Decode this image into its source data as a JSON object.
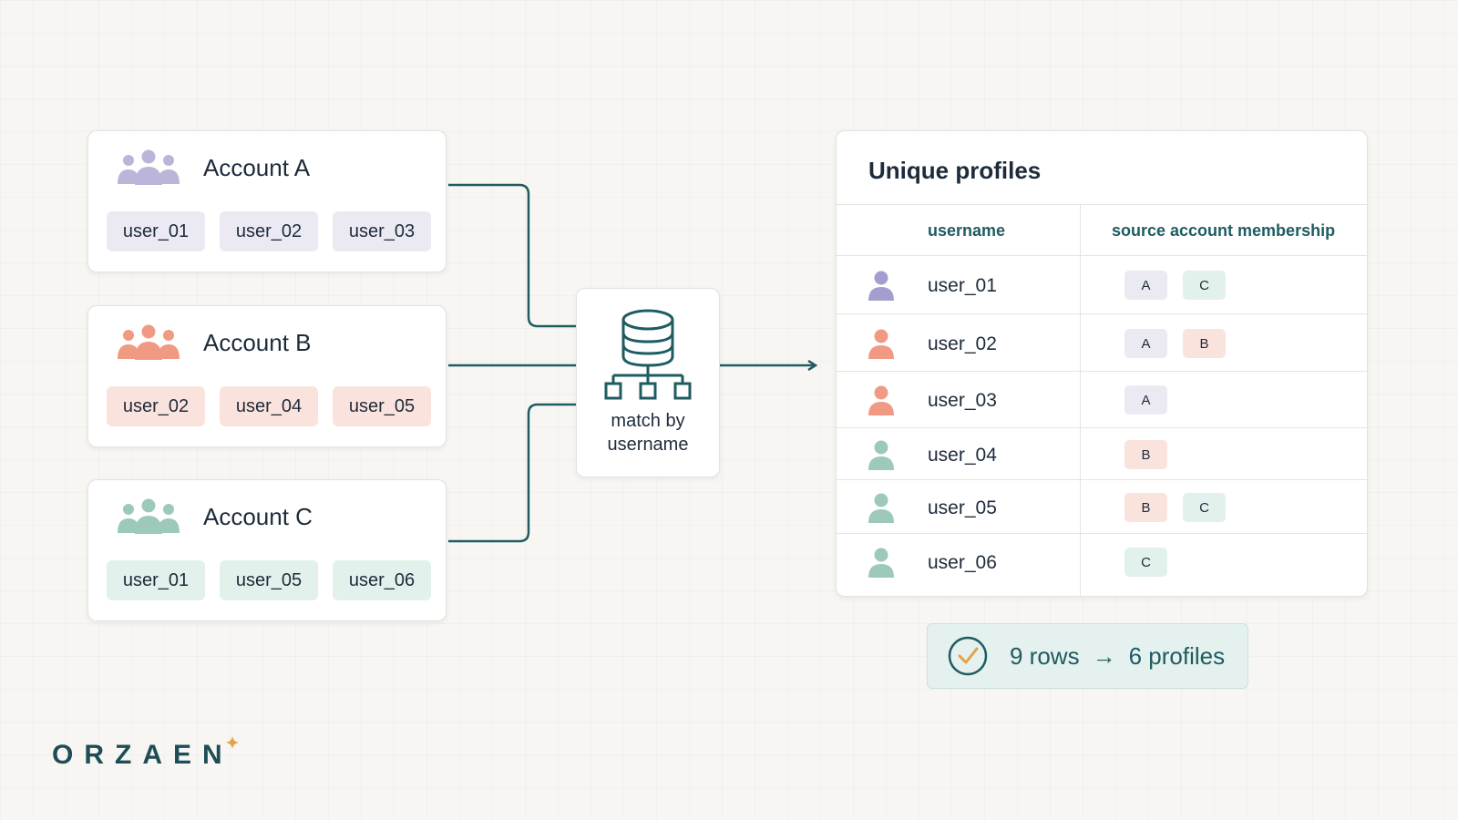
{
  "accounts": [
    {
      "title": "Account A",
      "users": [
        "user_01",
        "user_02",
        "user_03"
      ]
    },
    {
      "title": "Account B",
      "users": [
        "user_02",
        "user_04",
        "user_05"
      ]
    },
    {
      "title": "Account C",
      "users": [
        "user_01",
        "user_05",
        "user_06"
      ]
    }
  ],
  "match": {
    "label": "match by username"
  },
  "profiles": {
    "title": "Unique profiles",
    "columns": [
      "username",
      "source account membership"
    ],
    "rows": [
      {
        "username": "user_01",
        "sources": [
          "A",
          "C"
        ]
      },
      {
        "username": "user_02",
        "sources": [
          "A",
          "B"
        ]
      },
      {
        "username": "user_03",
        "sources": [
          "A"
        ]
      },
      {
        "username": "user_04",
        "sources": [
          "B"
        ]
      },
      {
        "username": "user_05",
        "sources": [
          "B",
          "C"
        ]
      },
      {
        "username": "user_06",
        "sources": [
          "C"
        ]
      }
    ]
  },
  "summary": {
    "rows_text": "9 rows",
    "arrow": "→",
    "profiles_text": "6 profiles"
  },
  "brand": {
    "name": "ORZAEN"
  },
  "colors": {
    "account_a": "#b9b6d9",
    "account_a_chip": "#ebeaf3",
    "account_b": "#f09a84",
    "account_b_chip": "#fbe3dd",
    "account_c": "#9cc9ba",
    "account_c_chip": "#e2f1ec",
    "teal": "#1e5c61",
    "accent": "#e3a34a"
  }
}
